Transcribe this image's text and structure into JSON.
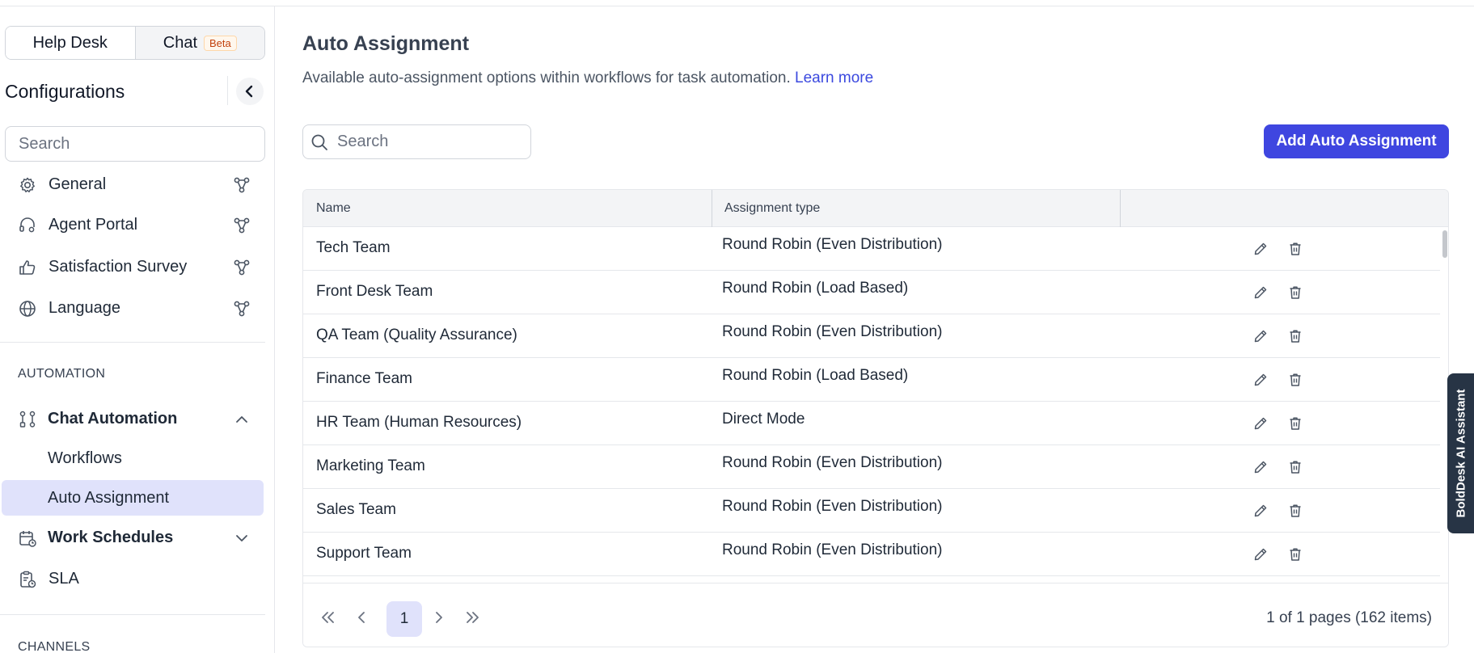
{
  "toggle": {
    "help_desk": "Help Desk",
    "chat": "Chat",
    "beta": "Beta"
  },
  "sidebar": {
    "title": "Configurations",
    "search_placeholder": "Search",
    "general_items": [
      {
        "label": "General",
        "icon": "gear-icon"
      },
      {
        "label": "Agent Portal",
        "icon": "headset-icon"
      },
      {
        "label": "Satisfaction Survey",
        "icon": "thumbs-up-icon"
      },
      {
        "label": "Language",
        "icon": "globe-icon"
      }
    ],
    "automation_label": "AUTOMATION",
    "chat_automation": "Chat Automation",
    "workflows": "Workflows",
    "auto_assignment": "Auto Assignment",
    "work_schedules": "Work Schedules",
    "sla": "SLA",
    "channels_label": "CHANNELS"
  },
  "main": {
    "title": "Auto Assignment",
    "description": "Available auto-assignment options within workflows for task automation.",
    "learn_more": "Learn more",
    "search_placeholder": "Search",
    "add_button": "Add Auto Assignment",
    "columns": {
      "name": "Name",
      "type": "Assignment type"
    },
    "rows": [
      {
        "name": "Tech Team",
        "type": "Round Robin (Even Distribution)"
      },
      {
        "name": "Front Desk Team",
        "type": "Round Robin (Load Based)"
      },
      {
        "name": "QA Team (Quality Assurance)",
        "type": "Round Robin (Even Distribution)"
      },
      {
        "name": "Finance Team",
        "type": "Round Robin (Load Based)"
      },
      {
        "name": "HR Team (Human Resources)",
        "type": "Direct Mode"
      },
      {
        "name": "Marketing Team",
        "type": "Round Robin (Even Distribution)"
      },
      {
        "name": "Sales Team",
        "type": "Round Robin (Even Distribution)"
      },
      {
        "name": "Support Team",
        "type": "Round Robin (Even Distribution)"
      }
    ],
    "pager": {
      "current_page": "1",
      "info": "1 of 1 pages (162 items)"
    }
  },
  "assistant_tab": "BoldDesk AI Assistant",
  "colors": {
    "primary": "#3f46e0",
    "active_bg": "#e0e2fb",
    "link": "#3b49df"
  }
}
